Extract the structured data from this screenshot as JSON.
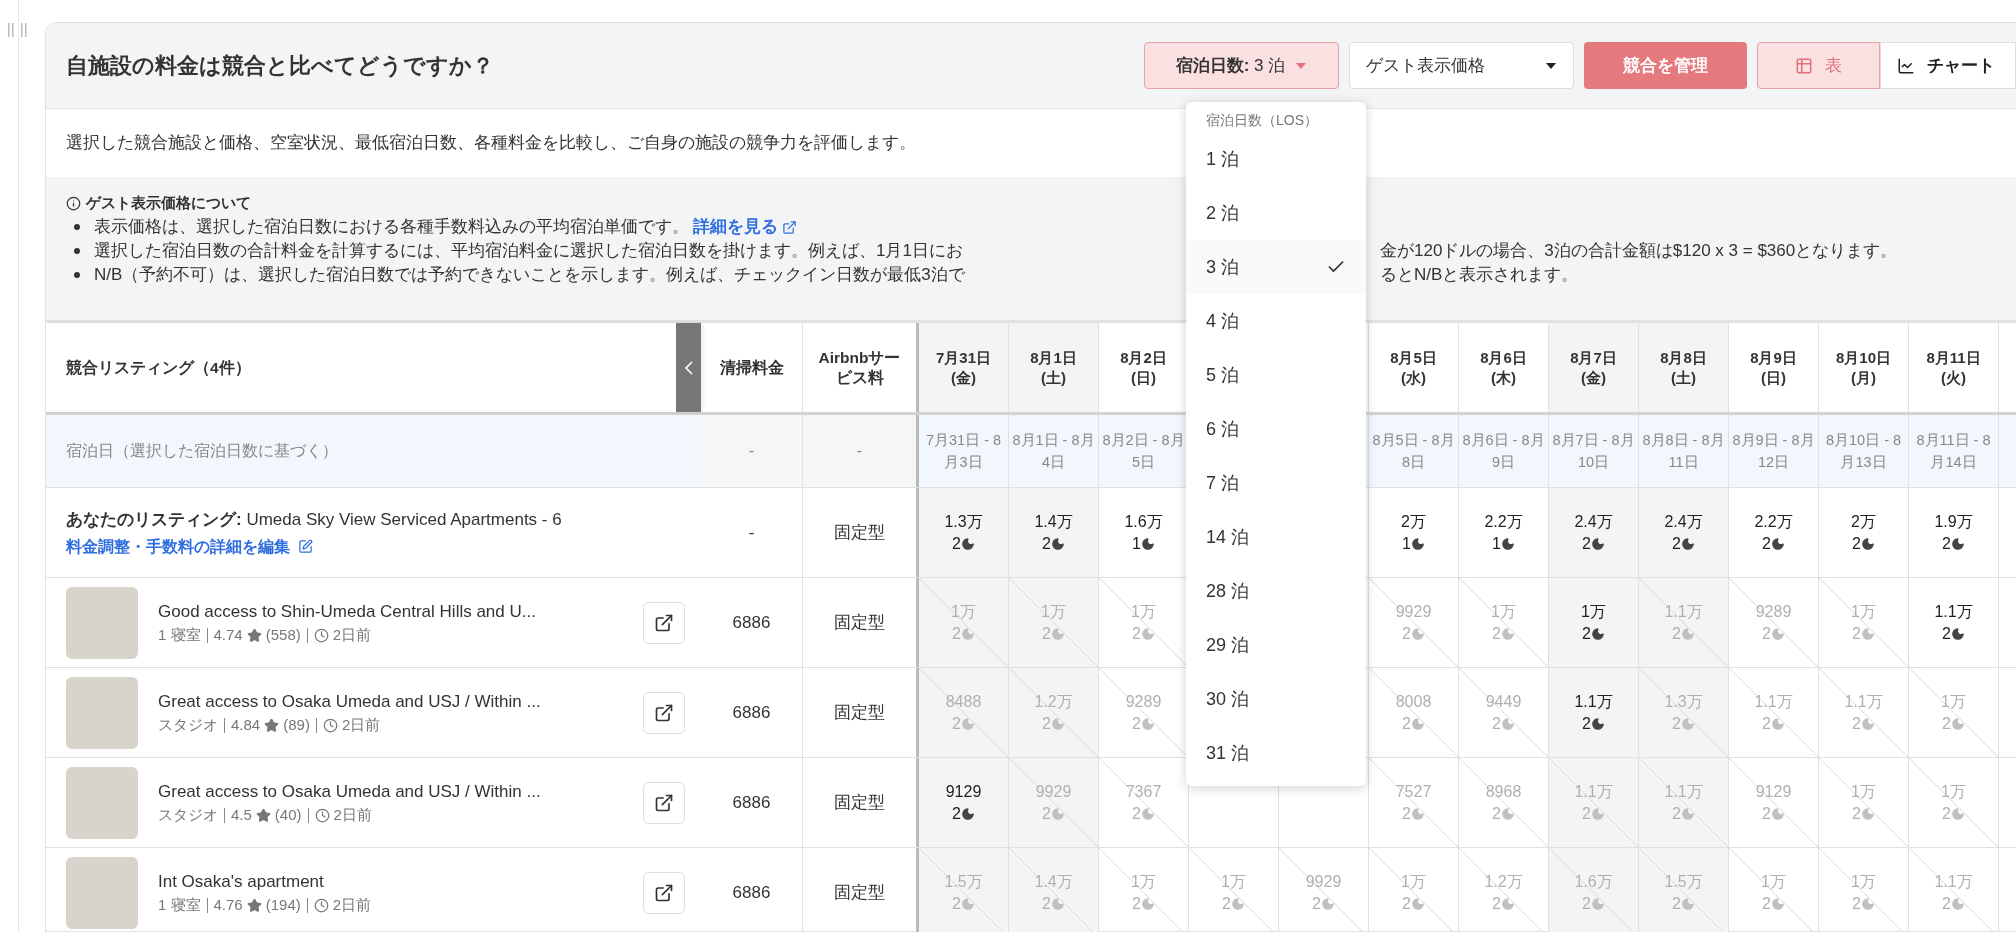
{
  "header": {
    "title": "自施設の料金は競合と比べてどうですか？",
    "los_button": {
      "label": "宿泊日数:",
      "value": "3 泊"
    },
    "price_button": {
      "label": "ゲスト表示価格"
    },
    "manage_button": {
      "label": "競合を管理"
    },
    "view_tabs": [
      {
        "label": "表",
        "selected": true
      },
      {
        "label": "チャート",
        "selected": false
      }
    ]
  },
  "los_menu": {
    "heading": "宿泊日数（LOS）",
    "items": [
      {
        "label": "1 泊",
        "selected": false
      },
      {
        "label": "2 泊",
        "selected": false
      },
      {
        "label": "3 泊",
        "selected": true
      },
      {
        "label": "4 泊",
        "selected": false
      },
      {
        "label": "5 泊",
        "selected": false
      },
      {
        "label": "6 泊",
        "selected": false
      },
      {
        "label": "7 泊",
        "selected": false
      },
      {
        "label": "14 泊",
        "selected": false
      },
      {
        "label": "28 泊",
        "selected": false
      },
      {
        "label": "29 泊",
        "selected": false
      },
      {
        "label": "30 泊",
        "selected": false
      },
      {
        "label": "31 泊",
        "selected": false
      }
    ]
  },
  "description": "選択した競合施設と価格、空室状況、最低宿泊日数、各種料金を比較し、ご自身の施設の競争力を評価します。",
  "info": {
    "title": "ゲスト表示価格について",
    "bullets": [
      {
        "parts": [
          "表示価格は、選択した宿泊日数における各種手数料込みの平均宿泊単価です。"
        ],
        "link": "詳細を見る"
      },
      {
        "parts": [
          "選択した宿泊日数の合計料金を計算するには、平均宿泊料金に選択した宿泊日数を掛けます。例えば、1月1日にお",
          "金が120ドルの場合、3泊の合計金額は$120 x 3 = $360となります。"
        ]
      },
      {
        "parts": [
          "N/B（予約不可）は、選択した宿泊日数では予約できないことを示します。例えば、チェックイン日数が最低3泊で",
          "るとN/Bと表示されます。"
        ]
      }
    ]
  },
  "table": {
    "listing_header": "競合リスティング（4件）",
    "cleaning_header": "清掃料金",
    "fee_header": "Airbnbサービス料",
    "stay_row": {
      "label": "宿泊日（選択した宿泊日数に基づく）",
      "cleaning": "-",
      "fee": "-"
    },
    "date_columns": [
      {
        "date": "7月31日",
        "weekday": "(金)",
        "stay": "7月31日 - 8月3日",
        "weekend": true
      },
      {
        "date": "8月1日",
        "weekday": "(土)",
        "stay": "8月1日 - 8月4日",
        "weekend": true
      },
      {
        "date": "8月2日",
        "weekday": "(日)",
        "stay": "8月2日 - 8月5日",
        "weekend": false
      },
      null,
      null,
      {
        "date": "8月5日",
        "weekday": "(水)",
        "stay": "8月5日 - 8月8日",
        "weekend": false
      },
      {
        "date": "8月6日",
        "weekday": "(木)",
        "stay": "8月6日 - 8月9日",
        "weekend": false
      },
      {
        "date": "8月7日",
        "weekday": "(金)",
        "stay": "8月7日 - 8月10日",
        "weekend": true
      },
      {
        "date": "8月8日",
        "weekday": "(土)",
        "stay": "8月8日 - 8月11日",
        "weekend": true
      },
      {
        "date": "8月9日",
        "weekday": "(日)",
        "stay": "8月9日 - 8月12日",
        "weekend": false
      },
      {
        "date": "8月10日",
        "weekday": "(月)",
        "stay": "8月10日 - 8月13日",
        "weekend": false
      },
      {
        "date": "8月11日",
        "weekday": "(火)",
        "stay": "8月11日 - 8月14日",
        "weekend": false
      }
    ],
    "my_listing": {
      "label": "あなたのリスティング:",
      "name": "Umeda Sky View Serviced Apartments - 6",
      "edit_link": "料金調整・手数料の詳細を編集",
      "cleaning": "-",
      "fee": "固定型",
      "cells": [
        {
          "price": "1.3万",
          "nights": "2",
          "available": true
        },
        {
          "price": "1.4万",
          "nights": "2",
          "available": true
        },
        {
          "price": "1.6万",
          "nights": "1",
          "available": true
        },
        null,
        null,
        {
          "price": "2万",
          "nights": "1",
          "available": true
        },
        {
          "price": "2.2万",
          "nights": "1",
          "available": true
        },
        {
          "price": "2.4万",
          "nights": "2",
          "available": true
        },
        {
          "price": "2.4万",
          "nights": "2",
          "available": true
        },
        {
          "price": "2.2万",
          "nights": "2",
          "available": true
        },
        {
          "price": "2万",
          "nights": "2",
          "available": true
        },
        {
          "price": "1.9万",
          "nights": "2",
          "available": true
        }
      ]
    },
    "competitors": [
      {
        "title": "Good access to Shin-Umeda Central Hills and U...",
        "rooms": "1 寝室",
        "rating": "4.74",
        "reviews": "(558)",
        "updated": "2日前",
        "cleaning": "6886",
        "fee": "固定型",
        "cells": [
          {
            "price": "1万",
            "nights": "2",
            "available": false
          },
          {
            "price": "1万",
            "nights": "2",
            "available": false
          },
          {
            "price": "1万",
            "nights": "2",
            "available": false
          },
          null,
          null,
          {
            "price": "9929",
            "nights": "2",
            "available": false
          },
          {
            "price": "1万",
            "nights": "2",
            "available": false
          },
          {
            "price": "1万",
            "nights": "2",
            "available": true
          },
          {
            "price": "1.1万",
            "nights": "2",
            "available": false
          },
          {
            "price": "9289",
            "nights": "2",
            "available": false
          },
          {
            "price": "1万",
            "nights": "2",
            "available": false
          },
          {
            "price": "1.1万",
            "nights": "2",
            "available": true
          }
        ]
      },
      {
        "title": "Great access to Osaka Umeda and USJ / Within ...",
        "rooms": "スタジオ",
        "rating": "4.84",
        "reviews": "(89)",
        "updated": "2日前",
        "cleaning": "6886",
        "fee": "固定型",
        "cells": [
          {
            "price": "8488",
            "nights": "2",
            "available": false
          },
          {
            "price": "1.2万",
            "nights": "2",
            "available": false
          },
          {
            "price": "9289",
            "nights": "2",
            "available": false
          },
          null,
          null,
          {
            "price": "8008",
            "nights": "2",
            "available": false
          },
          {
            "price": "9449",
            "nights": "2",
            "available": false
          },
          {
            "price": "1.1万",
            "nights": "2",
            "available": true
          },
          {
            "price": "1.3万",
            "nights": "2",
            "available": false
          },
          {
            "price": "1.1万",
            "nights": "2",
            "available": false
          },
          {
            "price": "1.1万",
            "nights": "2",
            "available": false
          },
          {
            "price": "1万",
            "nights": "2",
            "available": false
          }
        ]
      },
      {
        "title": "Great access to Osaka Umeda and USJ / Within ...",
        "rooms": "スタジオ",
        "rating": "4.5",
        "reviews": "(40)",
        "updated": "2日前",
        "cleaning": "6886",
        "fee": "固定型",
        "cells": [
          {
            "price": "9129",
            "nights": "2",
            "available": true
          },
          {
            "price": "9929",
            "nights": "2",
            "available": false
          },
          {
            "price": "7367",
            "nights": "2",
            "available": false
          },
          null,
          null,
          {
            "price": "7527",
            "nights": "2",
            "available": false
          },
          {
            "price": "8968",
            "nights": "2",
            "available": false
          },
          {
            "price": "1.1万",
            "nights": "2",
            "available": false
          },
          {
            "price": "1.1万",
            "nights": "2",
            "available": false
          },
          {
            "price": "9129",
            "nights": "2",
            "available": false
          },
          {
            "price": "1万",
            "nights": "2",
            "available": false
          },
          {
            "price": "1万",
            "nights": "2",
            "available": false
          }
        ]
      },
      {
        "title": "Int Osaka's apartment",
        "rooms": "1 寝室",
        "rating": "4.76",
        "reviews": "(194)",
        "updated": "2日前",
        "cleaning": "6886",
        "fee": "固定型",
        "cells": [
          {
            "price": "1.5万",
            "nights": "2",
            "available": false
          },
          {
            "price": "1.4万",
            "nights": "2",
            "available": false
          },
          {
            "price": "1万",
            "nights": "2",
            "available": false
          },
          {
            "price": "1万",
            "nights": "2",
            "available": false
          },
          {
            "price": "9929",
            "nights": "2",
            "available": false
          },
          {
            "price": "1万",
            "nights": "2",
            "available": false
          },
          {
            "price": "1.2万",
            "nights": "2",
            "available": false
          },
          {
            "price": "1.6万",
            "nights": "2",
            "available": false
          },
          {
            "price": "1.5万",
            "nights": "2",
            "available": false
          },
          {
            "price": "1万",
            "nights": "2",
            "available": false
          },
          {
            "price": "1万",
            "nights": "2",
            "available": false
          },
          {
            "price": "1.1万",
            "nights": "2",
            "available": false
          }
        ]
      }
    ]
  }
}
